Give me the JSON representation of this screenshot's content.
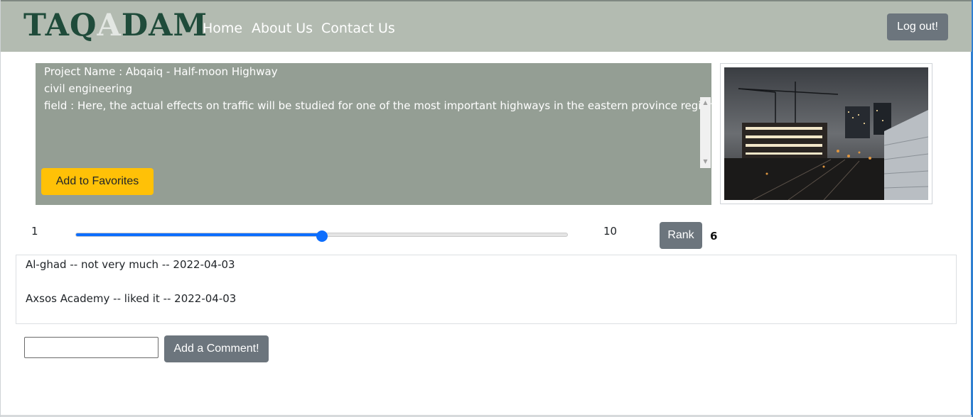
{
  "nav": {
    "logo_pre": "TAQ",
    "logo_hi": "A",
    "logo_post": "DAM",
    "links": [
      "Home",
      "About Us",
      "Contact Us"
    ],
    "logout_label": "Log out!"
  },
  "project": {
    "name_line": "Project Name : Abqaiq - Half-moon Highway",
    "category": "civil engineering",
    "field_line": "field : Here, the actual effects on traffic will be studied for one of the most important highways in the eastern province region",
    "favorite_label": "Add to Favorites"
  },
  "rank": {
    "min_label": "1",
    "max_label": "10",
    "min": 1,
    "max": 10,
    "value": 5.5,
    "button_label": "Rank",
    "current": "6"
  },
  "comments": [
    "Al-ghad -- not very much -- 2022-04-03",
    "Axsos Academy -- liked it -- 2022-04-03"
  ],
  "comment_form": {
    "input_value": "",
    "submit_label": "Add a Comment!"
  },
  "colors": {
    "navbar": "#b3bbb1",
    "project_bg": "#949e94",
    "warning": "#ffc107",
    "secondary": "#6c757d",
    "primary": "#0d6efd"
  }
}
